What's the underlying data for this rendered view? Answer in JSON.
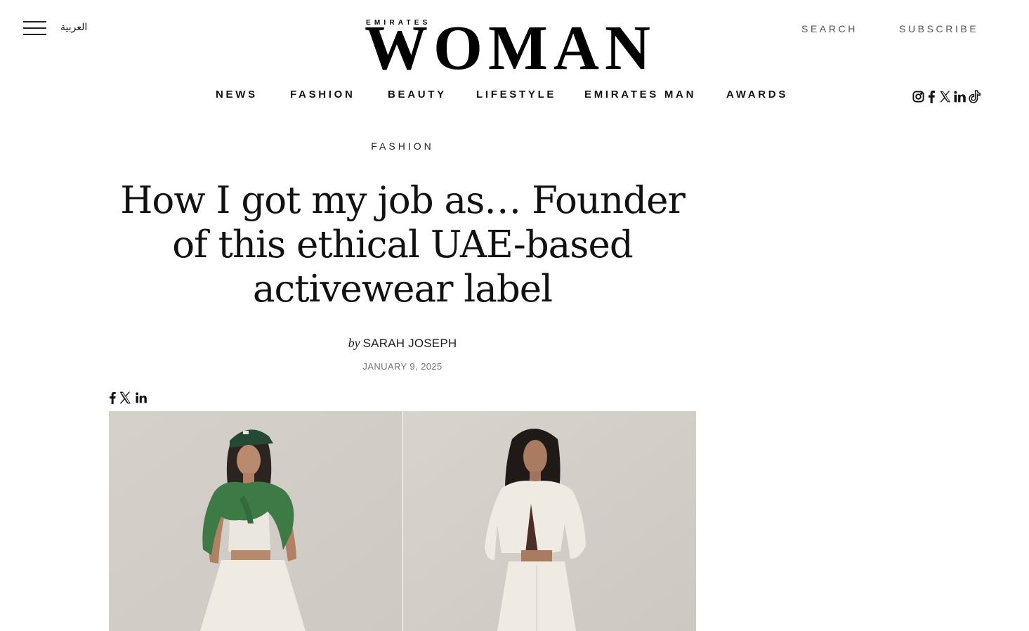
{
  "header": {
    "arabic_label": "العربية",
    "logo_small": "EMIRATES",
    "logo_big": "WOMAN",
    "search_label": "SEARCH",
    "subscribe_label": "SUBSCRIBE"
  },
  "nav": {
    "items": [
      "NEWS",
      "FASHION",
      "BEAUTY",
      "LIFESTYLE",
      "EMIRATES MAN",
      "AWARDS"
    ]
  },
  "social_icons": [
    "instagram-icon",
    "facebook-icon",
    "x-icon",
    "linkedin-icon",
    "tiktok-icon"
  ],
  "article": {
    "category": "FASHION",
    "headline": "How I got my job as… Founder of this ethical UAE-based activewear label",
    "byline_prefix": "by",
    "author": "SARAH JOSEPH",
    "date": "JANUARY 9, 2025",
    "share_icons": [
      "facebook-icon",
      "x-icon",
      "linkedin-icon"
    ]
  },
  "colors": {
    "background": "#ffffff",
    "text": "#111111",
    "muted": "#777777",
    "hero_backdrop": "#d9d4cf",
    "cardigan_green": "#3e7a45",
    "outfit_cream": "#efebe2"
  }
}
